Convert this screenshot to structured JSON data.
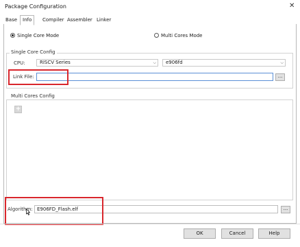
{
  "window": {
    "title": "Package Configuration",
    "close_glyph": "✕"
  },
  "tabs": [
    {
      "label": "Base",
      "active": false
    },
    {
      "label": "Info",
      "active": true
    },
    {
      "label": "Compiler",
      "active": false
    },
    {
      "label": "Assembler",
      "active": false
    },
    {
      "label": "Linker",
      "active": false
    }
  ],
  "mode": {
    "single_label": "Single Core Mode",
    "multi_label": "Multi Cores Mode",
    "selected": "single"
  },
  "single_core": {
    "group_title": "Single Core Config",
    "cpu_label": "CPU:",
    "cpu_family": "RISCV Series",
    "cpu_model": "e906fd",
    "link_file_label": "Link File:",
    "link_file_value": "",
    "browse_label": "..."
  },
  "multi_core": {
    "group_title": "Multi Cores Config",
    "add_glyph": "+"
  },
  "algorithm": {
    "label": "Algorithm:",
    "value": "E906FD_Flash.elf",
    "browse_label": "..."
  },
  "buttons": {
    "ok": "OK",
    "cancel": "Cancel",
    "help": "Help"
  },
  "icons": {
    "chevron": "chevron-down-icon",
    "close": "close-icon",
    "add": "add-icon"
  },
  "colors": {
    "highlight": "#d9262c",
    "focus_border": "#5a8fd6"
  }
}
